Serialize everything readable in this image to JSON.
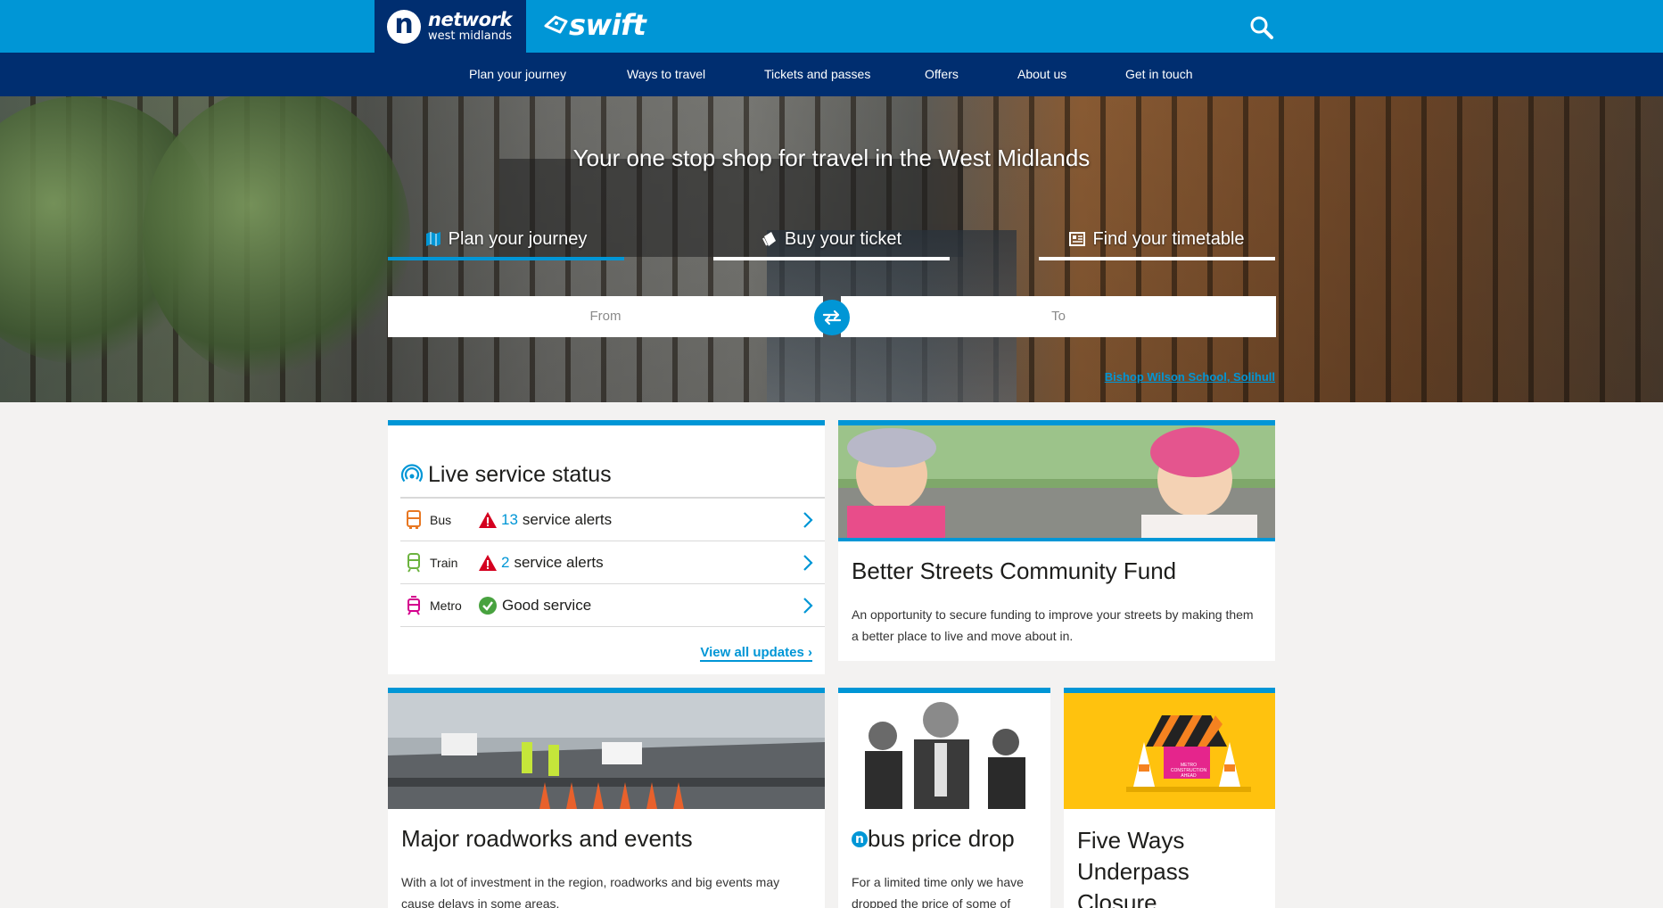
{
  "header": {
    "brand_name": "network",
    "brand_region": "west midlands",
    "brand_logo_letter": "n",
    "swift_label": "swift"
  },
  "nav": {
    "items": [
      "Plan your journey",
      "Ways to travel",
      "Tickets and passes",
      "Offers",
      "About us",
      "Get in touch"
    ]
  },
  "hero": {
    "title": "Your one stop shop for travel in the West Midlands",
    "tabs": [
      {
        "label": "Plan your journey",
        "icon": "map-icon",
        "active": true
      },
      {
        "label": "Buy your ticket",
        "icon": "ticket-icon",
        "active": false
      },
      {
        "label": "Find your timetable",
        "icon": "timetable-icon",
        "active": false
      }
    ],
    "from_placeholder": "From",
    "to_placeholder": "To",
    "photo_credit": "Bishop Wilson School, Solihull"
  },
  "status": {
    "title": "Live service status",
    "rows": [
      {
        "mode": "Bus",
        "count": "13",
        "text": "service alerts",
        "state": "warning",
        "color": "#e87722"
      },
      {
        "mode": "Train",
        "count": "2",
        "text": "service alerts",
        "state": "warning",
        "color": "#6cb33f"
      },
      {
        "mode": "Metro",
        "count": "",
        "text": "Good service",
        "state": "good",
        "color": "#d4008d"
      }
    ],
    "view_all": "View all updates"
  },
  "cards": {
    "fund": {
      "title": "Better Streets Community Fund",
      "text": "An opportunity to secure funding to improve your streets by making them a better place to live and move about in."
    },
    "roads": {
      "title": "Major roadworks and events",
      "text": "With a lot of investment in the region, roadworks and big events may cause delays in some areas."
    },
    "bus": {
      "logo_letter": "n",
      "title": "bus price drop",
      "text": "For a limited time only we have dropped the price of some of"
    },
    "five": {
      "title": "Five Ways Underpass Closure",
      "sign_text": "METRO CONSTRUCTION AHEAD"
    }
  },
  "colors": {
    "primary": "#0096d6",
    "navy": "#002e70",
    "warning": "#d4001f",
    "good": "#48a23f"
  }
}
